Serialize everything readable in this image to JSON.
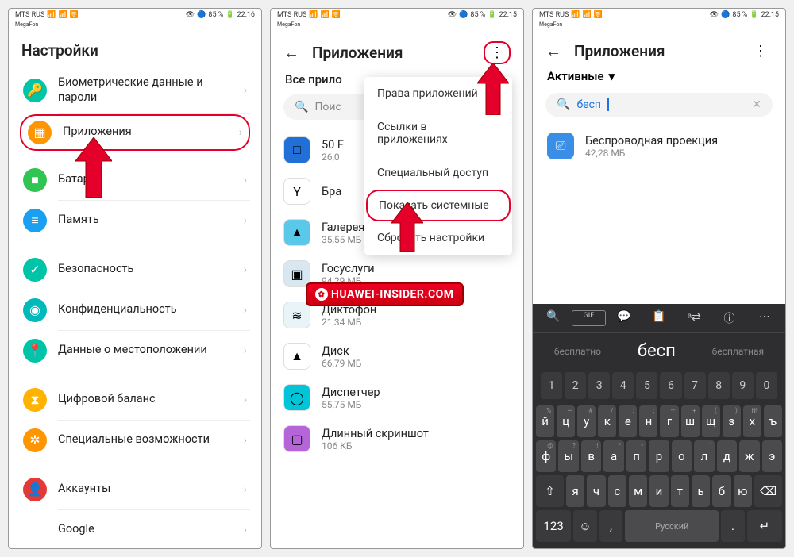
{
  "status": {
    "carrier": "MTS RUS",
    "carrier2": "MegaFon",
    "battery": "85 %",
    "time1": "22:16",
    "time2": "22:15",
    "time3": "22:15"
  },
  "panel1": {
    "title": "Настройки",
    "items": [
      {
        "label": "Биометрические данные и пароли",
        "color": "#00c4a7",
        "icon": "key-icon"
      },
      {
        "label": "Приложения",
        "color": "#ff9500",
        "icon": "grid-icon",
        "hl": true
      },
      {
        "label": "Батарея",
        "color": "#30c452",
        "icon": "battery-icon"
      },
      {
        "label": "Память",
        "color": "#1a9ff1",
        "icon": "storage-icon"
      },
      {
        "label": "Безопасность",
        "color": "#00c4a7",
        "icon": "shield-icon"
      },
      {
        "label": "Конфиденциальность",
        "color": "#00b9b9",
        "icon": "eye-icon"
      },
      {
        "label": "Данные о местоположении",
        "color": "#00c4a7",
        "icon": "pin-icon"
      },
      {
        "label": "Цифровой баланс",
        "color": "#ffb300",
        "icon": "hourglass-icon"
      },
      {
        "label": "Специальные возможности",
        "color": "#ff9500",
        "icon": "accessibility-icon"
      },
      {
        "label": "Аккаунты",
        "color": "#e53935",
        "icon": "person-icon"
      },
      {
        "label": "Google",
        "color": "#ffffff",
        "icon": "google-icon"
      }
    ]
  },
  "panel2": {
    "title": "Приложения",
    "subhead": "Все прило",
    "search_ph": "Поис",
    "menu": [
      "Права приложений",
      "Ссылки в приложениях",
      "Специальный доступ",
      "Показать системные",
      "Сбросить настройки"
    ],
    "apps": [
      {
        "name": "50 F",
        "size": "26,0",
        "color": "#2070d8"
      },
      {
        "name": "Бра",
        "size": "",
        "color": "#fff"
      },
      {
        "name": "Галерея",
        "size": "35,55 МБ",
        "color": "#5ac8e8"
      },
      {
        "name": "Госуслуги",
        "size": "94,29 МБ",
        "color": "#d8e8f0"
      },
      {
        "name": "Диктофон",
        "size": "21,34 МБ",
        "color": "#e8f4f8"
      },
      {
        "name": "Диск",
        "size": "66,79 МБ",
        "color": "#fff"
      },
      {
        "name": "Диспетчер",
        "size": "55,75 МБ",
        "color": "#00c4d8"
      },
      {
        "name": "Длинный скриншот",
        "size": "106 КБ",
        "color": "#b565d8"
      }
    ],
    "watermark": "HUAWEI-INSIDER.COM"
  },
  "panel3": {
    "title": "Приложения",
    "filter": "Активные",
    "search_value": "бесп",
    "result": {
      "name": "Беспроводная проекция",
      "size": "42,28 МБ"
    },
    "keyboard": {
      "suggestions": {
        "left": "бесплатно",
        "main": "бесп",
        "right": "бесплатная"
      },
      "numrow": [
        "1",
        "2",
        "3",
        "4",
        "5",
        "6",
        "7",
        "8",
        "9",
        "0"
      ],
      "row1": [
        [
          "й",
          "%"
        ],
        [
          "ц",
          "~"
        ],
        [
          "у",
          "#"
        ],
        [
          "к",
          "/"
        ],
        [
          "е",
          ":"
        ],
        [
          "н",
          ";"
        ],
        [
          "г",
          "—"
        ],
        [
          "ш",
          "+"
        ],
        [
          "щ",
          "("
        ],
        [
          "з",
          ")"
        ],
        [
          "х",
          "№"
        ],
        [
          "ъ",
          ""
        ]
      ],
      "row2": [
        [
          "ф",
          "@"
        ],
        [
          "ы",
          "?"
        ],
        [
          "в",
          "!"
        ],
        [
          "а",
          "^"
        ],
        [
          "п",
          "*"
        ],
        [
          "р",
          ""
        ],
        [
          "о",
          ""
        ],
        [
          "л",
          "'"
        ],
        [
          "д",
          ""
        ],
        [
          "ж",
          ""
        ],
        [
          "э",
          ""
        ]
      ],
      "row3": [
        "я",
        "ч",
        "с",
        "м",
        "и",
        "т",
        "ь",
        "б",
        "ю"
      ],
      "space": "Русский",
      "k123": "123"
    }
  }
}
